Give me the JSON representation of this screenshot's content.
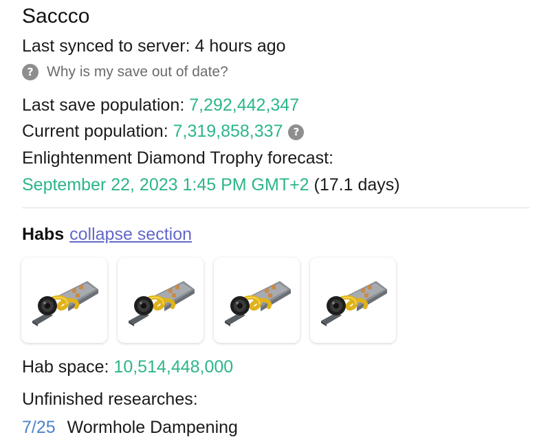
{
  "name": "Saccco",
  "sync": {
    "label": "Last synced to server: ",
    "value": "4 hours ago"
  },
  "help_link": {
    "icon": "question-icon",
    "text": "Why is my save out of date?"
  },
  "population": {
    "last_save_label": "Last save population: ",
    "last_save_value": "7,292,442,347",
    "current_label": "Current population: ",
    "current_value": "7,319,858,337",
    "info_icon": "question-icon"
  },
  "forecast": {
    "label": "Enlightenment Diamond Trophy forecast:",
    "date": "September 22, 2023 1:45 PM GMT+2",
    "duration": " (17.1 days)"
  },
  "habs": {
    "heading": "Habs",
    "collapse_label": "collapse section",
    "items": [
      {
        "icon": "hab-icon"
      },
      {
        "icon": "hab-icon"
      },
      {
        "icon": "hab-icon"
      },
      {
        "icon": "hab-icon"
      }
    ],
    "space_label": "Hab space: ",
    "space_value": "10,514,448,000"
  },
  "research": {
    "heading": "Unfinished researches:",
    "items": [
      {
        "progress": "7/25",
        "name": "Wormhole Dampening"
      }
    ]
  },
  "colors": {
    "value_green": "#2bb58a",
    "progress_blue": "#4a82c9",
    "link": "#6268c8"
  }
}
